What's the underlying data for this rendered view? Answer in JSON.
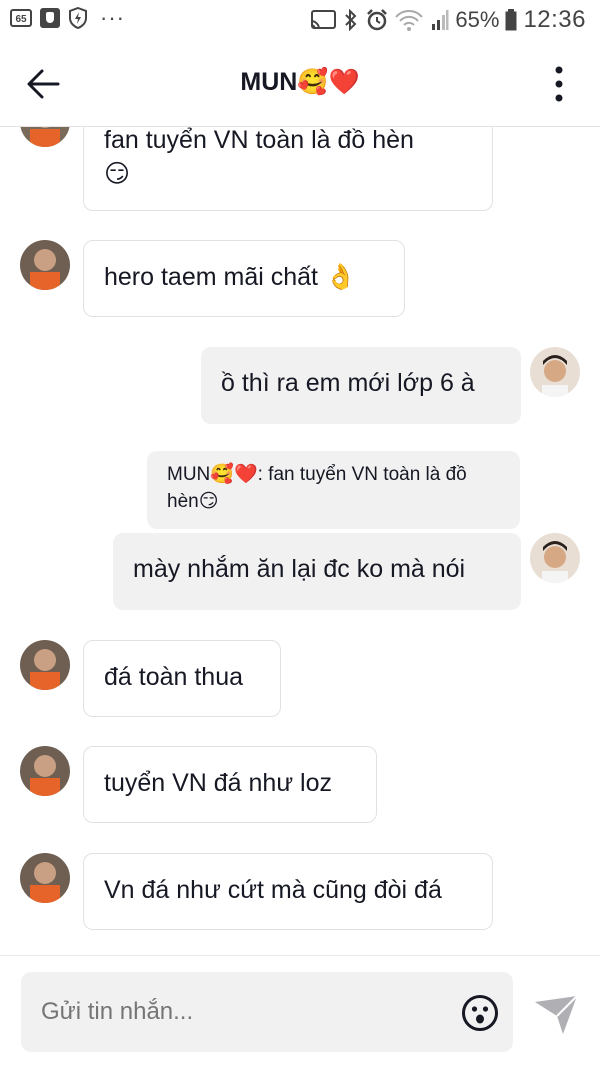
{
  "status_bar": {
    "badge": "65",
    "battery": "65%",
    "time": "12:36",
    "icons": [
      "cast-icon",
      "bluetooth-icon",
      "alarm-icon",
      "wifi-icon",
      "signal-icon",
      "battery-icon"
    ]
  },
  "header": {
    "title": "MUN",
    "title_emojis": "🥰❤️"
  },
  "messages": [
    {
      "side": "in",
      "text": "fan tuyển VN toàn là đồ hèn",
      "emoji": "😏"
    },
    {
      "side": "in",
      "text": "hero taem mãi chất",
      "emoji": "👌"
    },
    {
      "side": "out",
      "text": "ồ thì ra em mới lớp 6 à"
    },
    {
      "side": "quote",
      "prefix": "MUN",
      "prefix_emojis": "🥰❤️",
      "text": ": fan tuyển VN toàn là đồ hèn",
      "emoji": "😏"
    },
    {
      "side": "out",
      "text": "mày nhắm ăn lại đc ko mà nói"
    },
    {
      "side": "in",
      "text": "đá toàn thua"
    },
    {
      "side": "in",
      "text": "tuyển VN đá như loz"
    },
    {
      "side": "in",
      "text": "Vn đá như cứt mà cũng đòi đá"
    }
  ],
  "composer": {
    "placeholder": "Gửi tin nhắn..."
  },
  "colors": {
    "bubble_out": "#f1f1f2",
    "bubble_in_border": "#e2e2e3",
    "text": "#161823"
  }
}
